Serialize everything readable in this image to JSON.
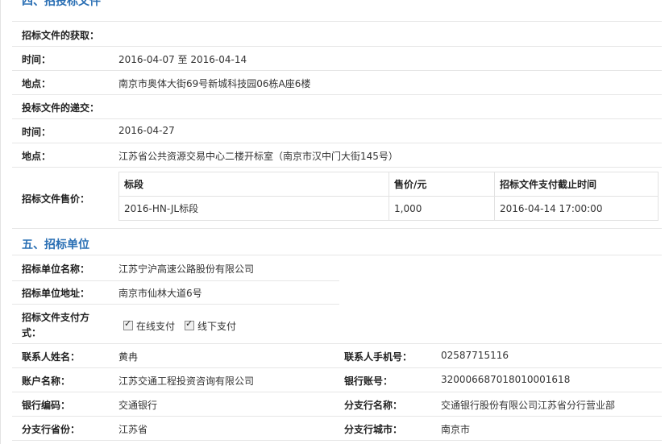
{
  "section4": {
    "title": "四、招投标文件"
  },
  "fetch": {
    "heading": "招标文件的获取：",
    "time_label": "时间：",
    "time_value": "2016-04-07 至 2016-04-14",
    "place_label": "地点：",
    "place_value": "南京市奥体大街69号新城科技园06栋A座6楼"
  },
  "submit": {
    "heading": "投标文件的递交：",
    "time_label": "时间：",
    "time_value": "2016-04-27",
    "place_label": "地点：",
    "place_value": "江苏省公共资源交易中心二楼开标室（南京市汉中门大街145号）"
  },
  "price": {
    "label": "招标文件售价：",
    "headers": [
      "标段",
      "售价/元",
      "招标文件支付截止时间"
    ],
    "rows": [
      [
        "2016-HN-JL标段",
        "1,000",
        "2016-04-14 17:00:00"
      ]
    ]
  },
  "section5": {
    "title": "五、招标单位"
  },
  "unit": {
    "name_label": "招标单位名称：",
    "name_value": "江苏宁沪高速公路股份有限公司",
    "addr_label": "招标单位地址：",
    "addr_value": "南京市仙林大道6号",
    "pay_label_line1": "招标文件支付方",
    "pay_label_line2": "式：",
    "pay_online": "在线支付",
    "pay_offline": "线下支付"
  },
  "contact": {
    "name_label": "联系人姓名：",
    "name_value": "黄冉",
    "phone_label": "联系人手机号：",
    "phone_value": "02587715116",
    "account_name_label": "账户名称：",
    "account_name_value": "江苏交通工程投资咨询有限公司",
    "account_no_label": "银行账号：",
    "account_no_value": "32000668701801000161​8",
    "bank_code_label": "银行编码：",
    "bank_code_value": "交通银行",
    "branch_name_label": "分支行名称：",
    "branch_name_value": "交通银行股份有限公司江苏省分行营业部",
    "province_label": "分支行省份：",
    "province_value": "江苏省",
    "city_label": "分支行城市：",
    "city_value": "南京市"
  }
}
